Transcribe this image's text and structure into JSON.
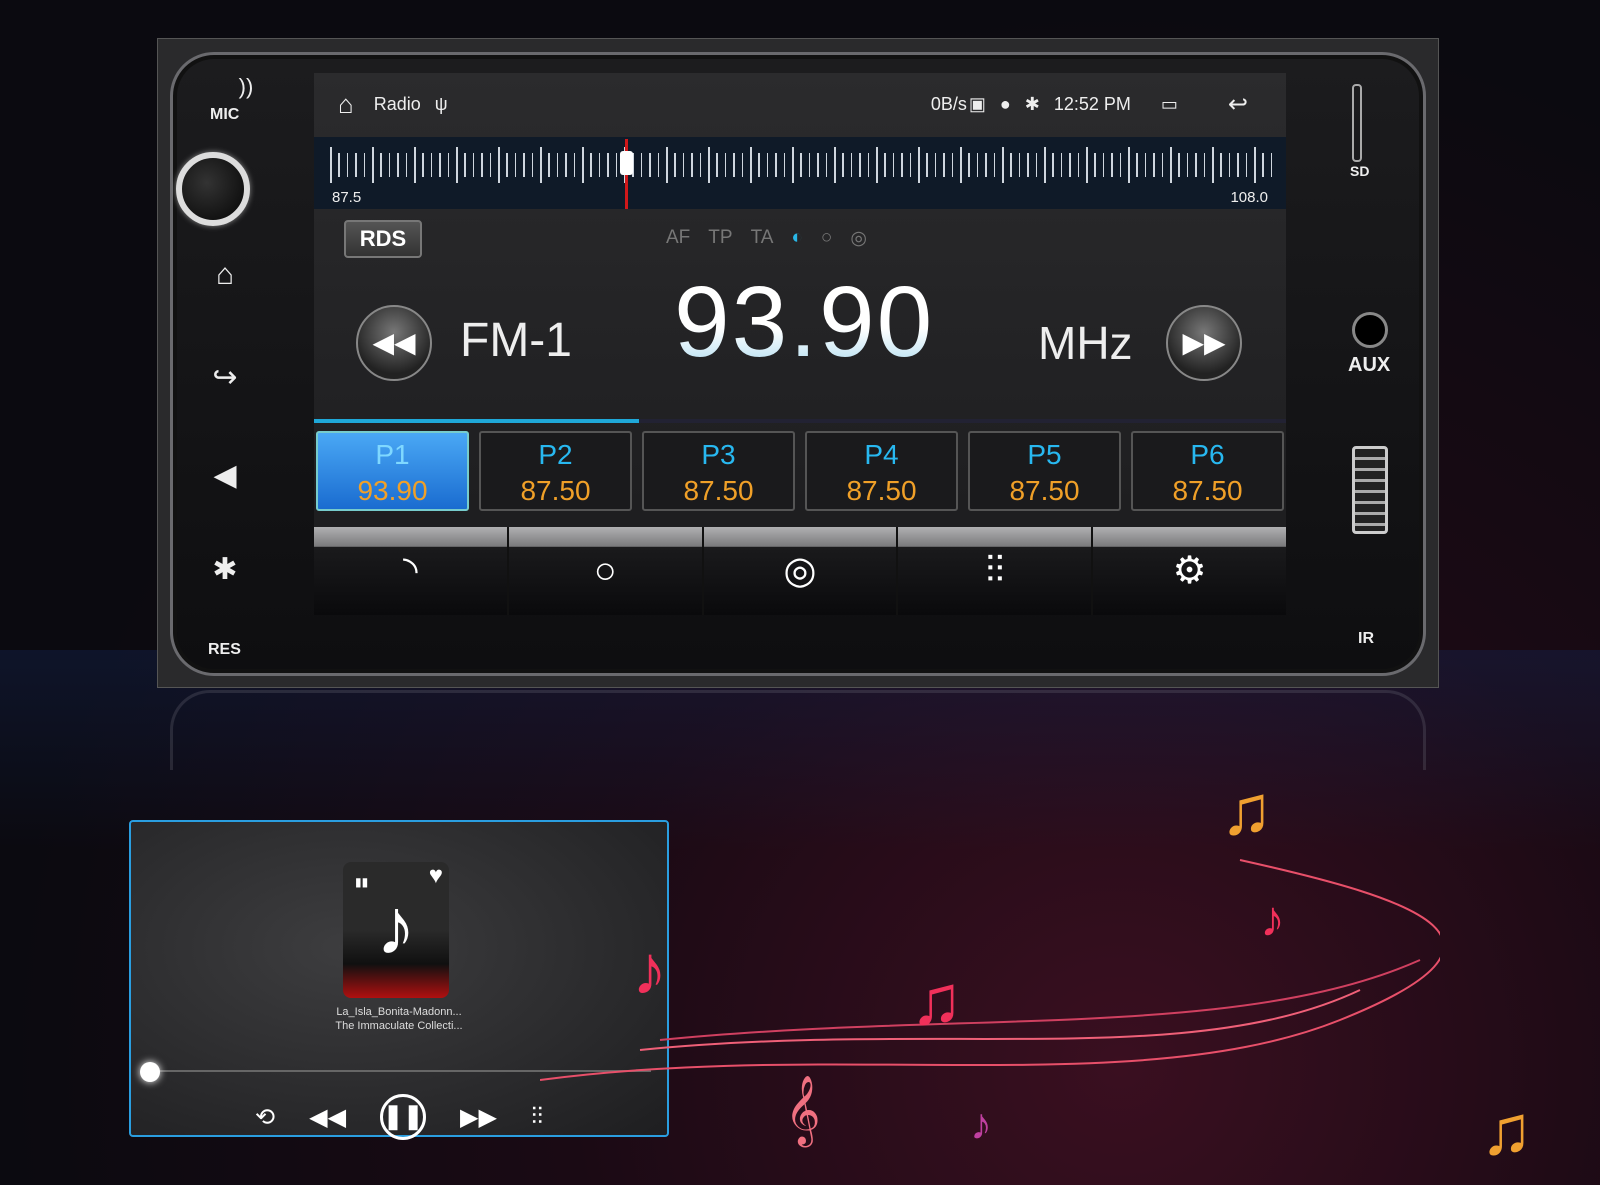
{
  "head_unit": {
    "left_labels": {
      "mic": "MIC",
      "res": "RES"
    },
    "right_labels": {
      "sd": "SD",
      "aux": "AUX",
      "ir": "IR"
    }
  },
  "status_bar": {
    "app_title": "Radio",
    "net_speed": "0B/s",
    "time": "12:52 PM"
  },
  "tuner": {
    "min_label": "87.5",
    "max_label": "108.0",
    "min": 87.5,
    "max": 108.0,
    "current": 93.9
  },
  "rds": {
    "label": "RDS",
    "flags": [
      "AF",
      "TP",
      "TA"
    ]
  },
  "radio": {
    "band": "FM-1",
    "frequency": "93.90",
    "unit": "MHz"
  },
  "presets": [
    {
      "label": "P1",
      "freq": "93.90",
      "active": true
    },
    {
      "label": "P2",
      "freq": "87.50"
    },
    {
      "label": "P3",
      "freq": "87.50"
    },
    {
      "label": "P4",
      "freq": "87.50"
    },
    {
      "label": "P5",
      "freq": "87.50"
    },
    {
      "label": "P6",
      "freq": "87.50"
    }
  ],
  "player": {
    "title": "La_Isla_Bonita-Madonn...",
    "album": "The Immaculate Collecti...",
    "progress": 0
  }
}
